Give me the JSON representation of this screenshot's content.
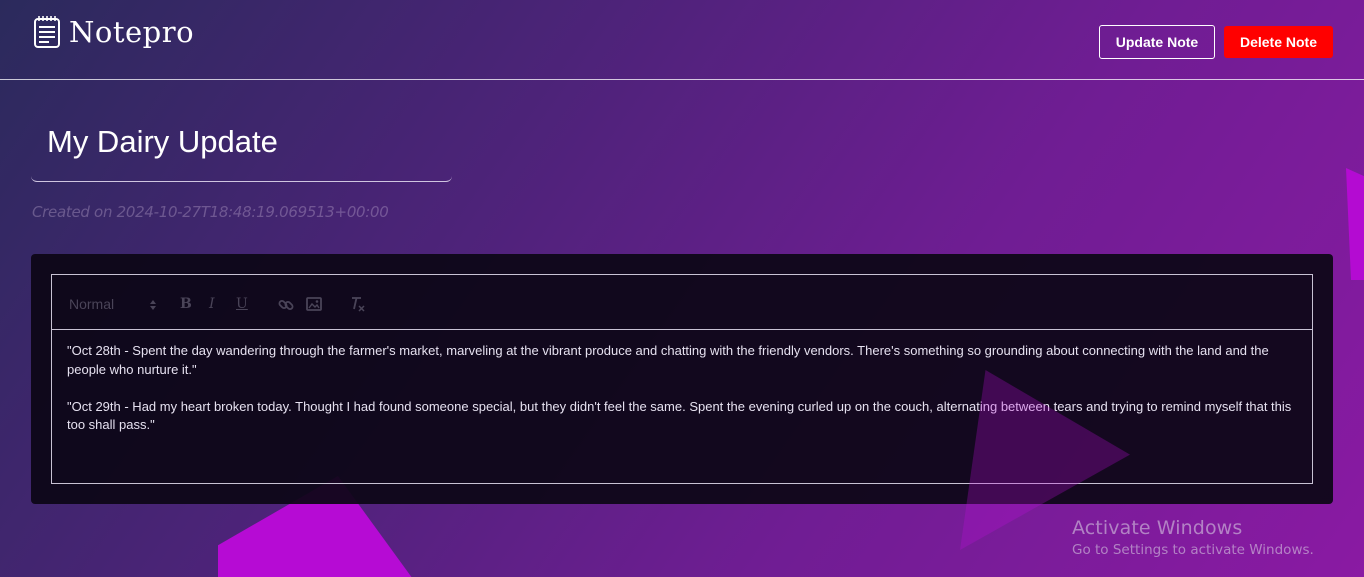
{
  "app": {
    "name": "Notepro",
    "logo_icon": "notepad-icon"
  },
  "header": {
    "update_label": "Update Note",
    "delete_label": "Delete Note",
    "delete_color": "#ff0000"
  },
  "note": {
    "title": "My Dairy Update",
    "created": "Created on 2024-10-27T18:48:19.069513+00:00",
    "paragraphs": [
      "\"Oct 28th - Spent the day wandering through the farmer's market, marveling at the vibrant produce and chatting with the friendly vendors. There's something so grounding about connecting with the land and the people who nurture it.\"",
      "\"Oct 29th - Had my heart broken today. Thought I had found someone special, but they didn't feel the same. Spent the evening curled up on the couch, alternating between tears and trying to remind myself that this too shall pass.\""
    ]
  },
  "toolbar": {
    "format_value": "Normal",
    "bold": "B",
    "italic": "I",
    "underline": "U",
    "icons": [
      "link-icon",
      "image-icon",
      "clear-format-icon"
    ]
  },
  "watermark": {
    "title": "Activate Windows",
    "subtitle": "Go to Settings to activate Windows."
  },
  "colors": {
    "accent_shape": "#b60bd4",
    "editor_bg": "#0c0616"
  }
}
